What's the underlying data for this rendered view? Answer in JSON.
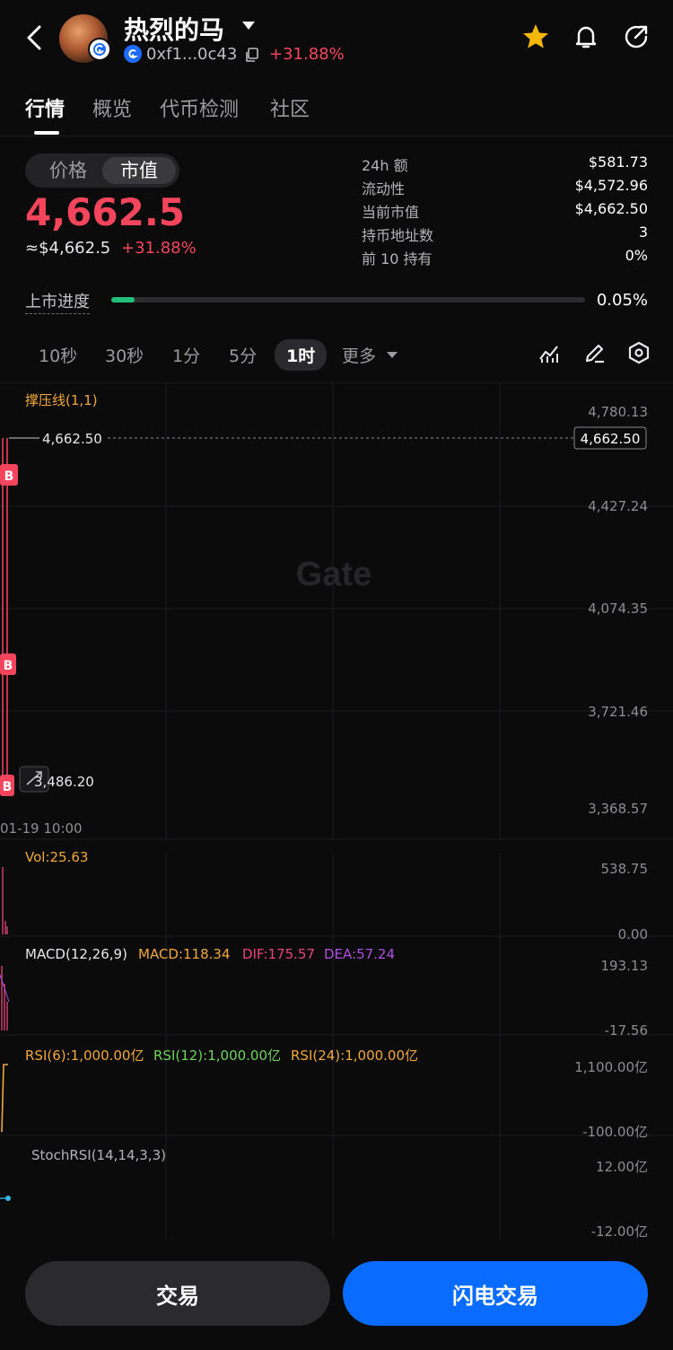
{
  "header": {
    "title": "热烈的马",
    "address": "0xf1...0c43",
    "change": "+31.88%"
  },
  "tabs": [
    "行情",
    "概览",
    "代币检测",
    "社区"
  ],
  "price_toggle": {
    "options": [
      "价格",
      "市值"
    ],
    "selected": "市值"
  },
  "main_value": "4,662.5",
  "usd_value": "≈$4,662.5",
  "usd_change": "+31.88%",
  "stats": [
    {
      "label": "24h  额",
      "value": "$581.73"
    },
    {
      "label": "流动性",
      "value": "$4,572.96"
    },
    {
      "label": "当前市值",
      "value": "$4,662.50"
    },
    {
      "label": "持币地址数",
      "value": "3"
    },
    {
      "label": "前 10 持有",
      "value": "0%"
    }
  ],
  "listing_progress": {
    "label": "上市进度",
    "percent_text": "0.05%",
    "fraction": 0.05
  },
  "intervals": [
    "10秒",
    "30秒",
    "1分",
    "5分",
    "1时",
    "更多"
  ],
  "active_interval": "1时",
  "chart_labels": {
    "indicator": "撑压线(1,1)",
    "high_marker": "4,662.50",
    "low_marker": "3,486.20",
    "current_tag": "4,662.50",
    "y_ticks": [
      "4,780.13",
      "4,427.24",
      "4,074.35",
      "3,721.46",
      "3,368.57"
    ],
    "time_label": "01-19 10:00",
    "watermark": "Gate",
    "buy_marker": "B"
  },
  "vol": {
    "label": "Vol:25.63",
    "max": "538.75",
    "min": "0.00"
  },
  "macd": {
    "name": "MACD(12,26,9)",
    "macd": "MACD:118.34",
    "dif": "DIF:175.57",
    "dea": "DEA:57.24",
    "max": "193.13",
    "min": "-17.56"
  },
  "rsi": {
    "r6": "RSI(6):1,000.00亿",
    "r12": "RSI(12):1,000.00亿",
    "r24": "RSI(24):1,000.00亿",
    "max": "1,100.00亿",
    "min": "-100.00亿"
  },
  "stochrsi": {
    "name": "StochRSI(14,14,3,3)",
    "max": "12.00亿",
    "min": "-12.00亿"
  },
  "buttons": {
    "trade": "交易",
    "flash": "闪电交易"
  },
  "colors": {
    "red": "#f5455c",
    "green": "#20c07a",
    "blue": "#0a6cff",
    "orange": "#f0a83a",
    "pink": "#e8457a",
    "purple": "#b04fe0",
    "lime": "#6fd35c",
    "cyan": "#39b6e8"
  }
}
